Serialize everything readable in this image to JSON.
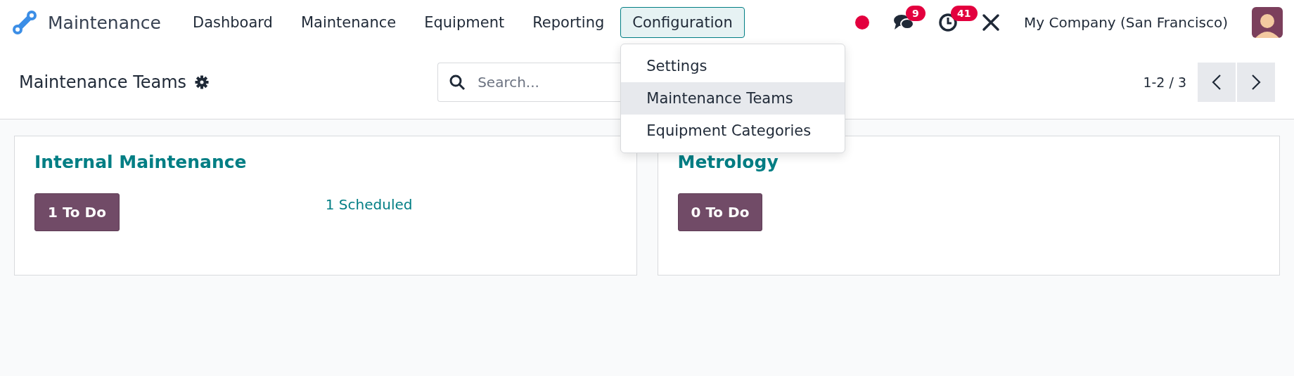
{
  "navbar": {
    "app_name": "Maintenance",
    "menu": [
      {
        "label": "Dashboard",
        "selected": false
      },
      {
        "label": "Maintenance",
        "selected": false
      },
      {
        "label": "Equipment",
        "selected": false
      },
      {
        "label": "Reporting",
        "selected": false
      },
      {
        "label": "Configuration",
        "selected": true
      }
    ],
    "messages_count": "9",
    "activities_count": "41",
    "company": "My Company (San Francisco)"
  },
  "dropdown": {
    "items": [
      {
        "label": "Settings",
        "selected": false
      },
      {
        "label": "Maintenance Teams",
        "selected": true
      },
      {
        "label": "Equipment Categories",
        "selected": false
      }
    ]
  },
  "control_panel": {
    "title": "Maintenance Teams",
    "search": {
      "placeholder": "Search..."
    },
    "pager": "1-2 / 3"
  },
  "teams": [
    {
      "name": "Internal Maintenance",
      "todo": "1 To Do",
      "scheduled": "1 Scheduled"
    },
    {
      "name": "Metrology",
      "todo": "0 To Do"
    }
  ]
}
